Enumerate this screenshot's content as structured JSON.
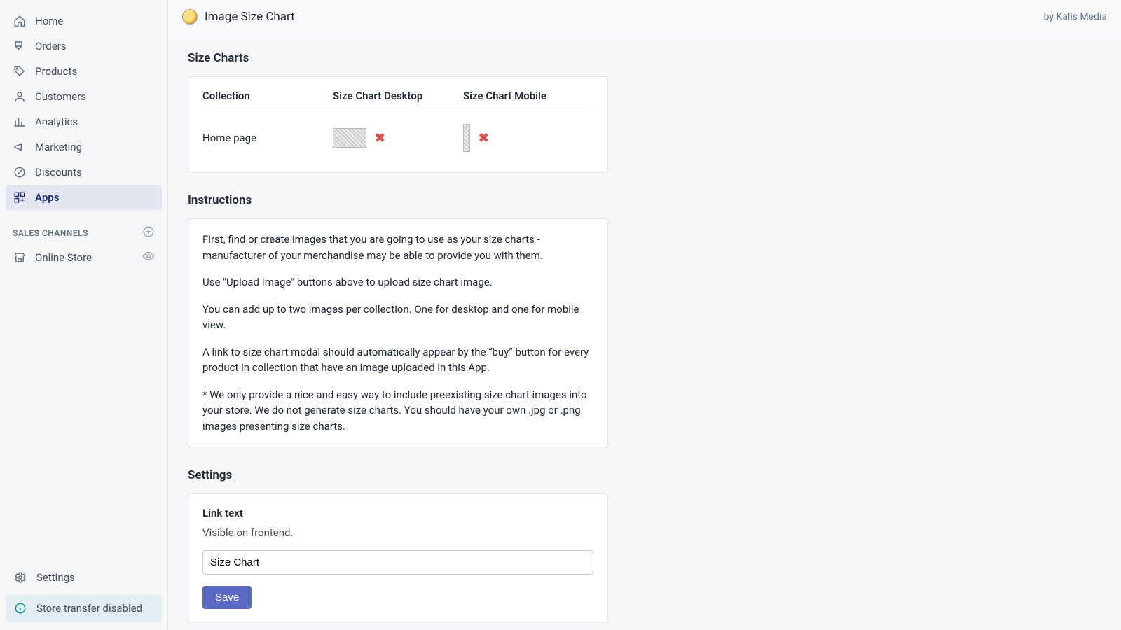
{
  "sidebar": {
    "items": [
      {
        "label": "Home"
      },
      {
        "label": "Orders"
      },
      {
        "label": "Products"
      },
      {
        "label": "Customers"
      },
      {
        "label": "Analytics"
      },
      {
        "label": "Marketing"
      },
      {
        "label": "Discounts"
      },
      {
        "label": "Apps"
      }
    ],
    "sales_channels_header": "Sales Channels",
    "sales_channels": [
      {
        "label": "Online Store"
      }
    ],
    "settings_label": "Settings",
    "transfer_label": "Store transfer disabled"
  },
  "header": {
    "app_title": "Image Size Chart",
    "byline": "by Kalis Media"
  },
  "size_charts": {
    "title": "Size Charts",
    "columns": {
      "collection": "Collection",
      "desktop": "Size Chart Desktop",
      "mobile": "Size Chart Mobile"
    },
    "rows": [
      {
        "collection": "Home page"
      }
    ]
  },
  "instructions": {
    "title": "Instructions",
    "paragraphs": [
      "First, find or create images that you are going to use as your size charts - manufacturer of your merchandise may be able to provide you with them.",
      "Use \"Upload Image\" buttons above to upload size chart image.",
      "You can add up to two images per collection. One for desktop and one for mobile view.",
      "A link to size chart modal should automatically appear by the “buy” button for every product in collection that have an image uploaded in this App.",
      "* We only provide a nice and easy way to include preexisting size chart images into your store. We do not generate size charts. You should have your own .jpg or .png images presenting size charts."
    ]
  },
  "settings": {
    "title": "Settings",
    "link_text_label": "Link text",
    "link_text_helper": "Visible on frontend.",
    "link_text_value": "Size Chart",
    "save_label": "Save"
  }
}
